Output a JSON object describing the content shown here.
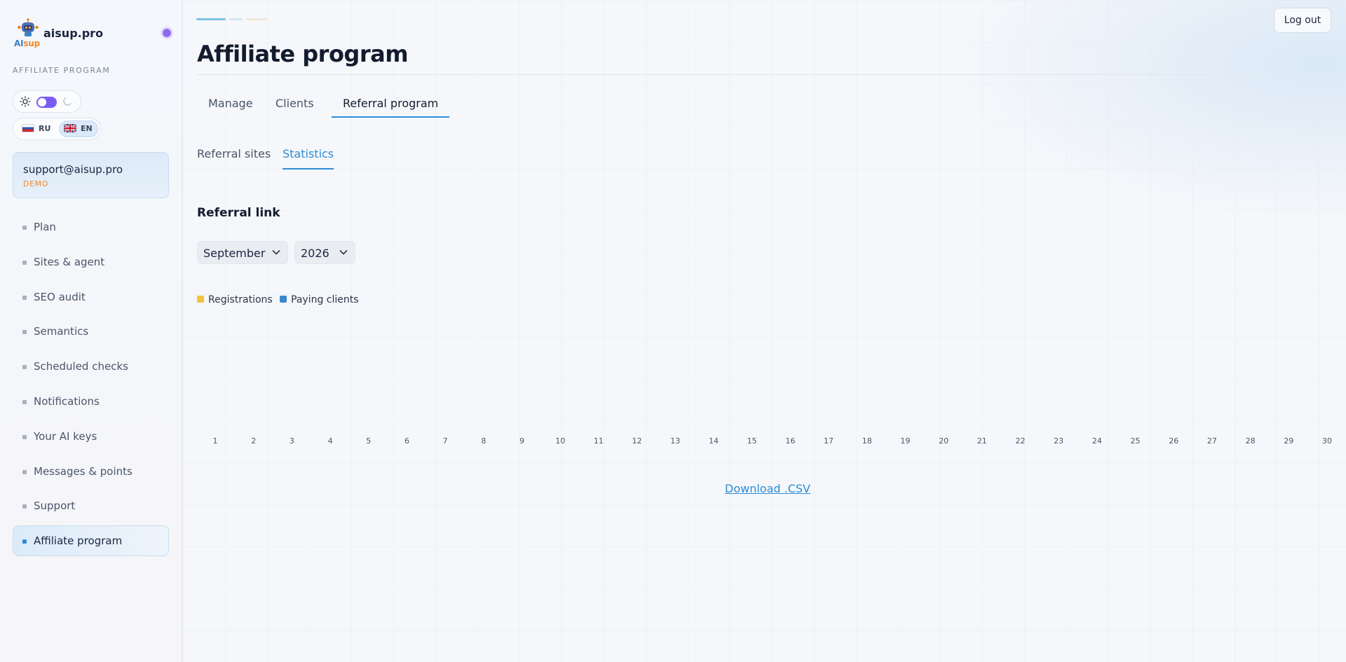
{
  "brand": {
    "name": "aisup.pro",
    "logo_text_ai": "AI",
    "logo_text_sup": "sup"
  },
  "sidebar": {
    "section_label": "AFFILIATE PROGRAM",
    "theme": {
      "mode": "dark-toggle-on"
    },
    "languages": [
      {
        "code": "RU",
        "active": false
      },
      {
        "code": "EN",
        "active": true
      }
    ],
    "account": {
      "email": "support@aisup.pro",
      "tag": "DEMO"
    },
    "items": [
      {
        "label": "Plan",
        "active": false
      },
      {
        "label": "Sites & agent",
        "active": false
      },
      {
        "label": "SEO audit",
        "active": false
      },
      {
        "label": "Semantics",
        "active": false
      },
      {
        "label": "Scheduled checks",
        "active": false
      },
      {
        "label": "Notifications",
        "active": false
      },
      {
        "label": "Your AI keys",
        "active": false
      },
      {
        "label": "Messages & points",
        "active": false
      },
      {
        "label": "Support",
        "active": false
      },
      {
        "label": "Affiliate program",
        "active": true
      }
    ]
  },
  "header": {
    "logout_label": "Log out"
  },
  "main": {
    "title": "Affiliate program",
    "tabs": [
      {
        "label": "Manage",
        "active": false
      },
      {
        "label": "Clients",
        "active": false
      },
      {
        "label": "Referral program",
        "active": true
      }
    ],
    "subtabs": [
      {
        "label": "Referral sites",
        "active": false
      },
      {
        "label": "Statistics",
        "active": true
      }
    ],
    "section_title": "Referral link",
    "filters": {
      "month": "September",
      "year": "2026"
    },
    "download_label": "Download .CSV"
  },
  "colors": {
    "accent": "#2d8bd6",
    "registrations": "#f2c23a",
    "paying_clients": "#3d86d0",
    "demo_tag": "#f08a2c"
  },
  "chart_data": {
    "type": "bar",
    "categories": [
      "1",
      "2",
      "3",
      "4",
      "5",
      "6",
      "7",
      "8",
      "9",
      "10",
      "11",
      "12",
      "13",
      "14",
      "15",
      "16",
      "17",
      "18",
      "19",
      "20",
      "21",
      "22",
      "23",
      "24",
      "25",
      "26",
      "27",
      "28",
      "29",
      "30"
    ],
    "series": [
      {
        "name": "Registrations",
        "values": [
          0,
          0,
          0,
          0,
          0,
          0,
          0,
          0,
          0,
          0,
          0,
          0,
          0,
          0,
          0,
          0,
          0,
          0,
          0,
          0,
          0,
          0,
          0,
          0,
          0,
          0,
          0,
          0,
          0,
          0
        ]
      },
      {
        "name": "Paying clients",
        "values": [
          0,
          0,
          0,
          0,
          0,
          0,
          0,
          0,
          0,
          0,
          0,
          0,
          0,
          0,
          0,
          0,
          0,
          0,
          0,
          0,
          0,
          0,
          0,
          0,
          0,
          0,
          0,
          0,
          0,
          0
        ]
      }
    ],
    "title": "",
    "xlabel": "",
    "ylabel": "",
    "grid": false,
    "legend": "top-left"
  }
}
